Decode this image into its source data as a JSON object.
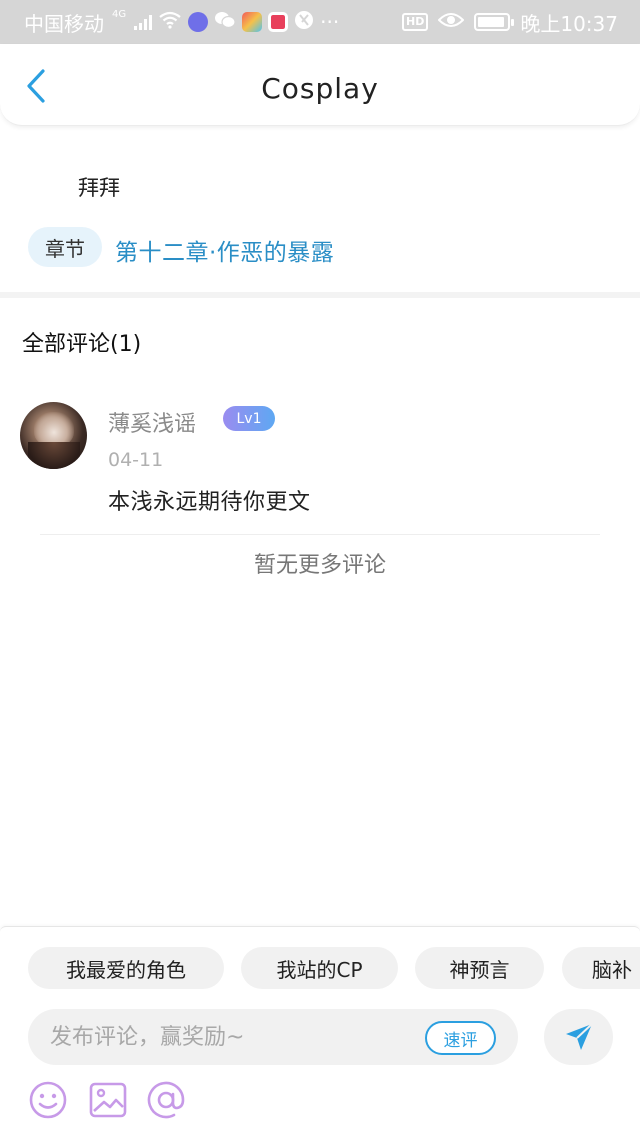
{
  "status_bar": {
    "carrier": "中国移动",
    "network": "4G",
    "time": "晚上10:37",
    "hd": "HD",
    "more": "···",
    "icons": [
      "signal-icon",
      "wifi-icon",
      "music-app-icon",
      "wechat-icon",
      "app-icon",
      "app-icon",
      "browser-icon",
      "eye-icon",
      "battery-icon"
    ]
  },
  "nav": {
    "title": "Cosplay",
    "back_icon": "chevron-left-icon"
  },
  "post": {
    "text": "拜拜",
    "chapter_tag": "章节",
    "chapter_title": "第十二章·作恶的暴露"
  },
  "comments": {
    "heading": "全部评论(1)",
    "items": [
      {
        "name": "薄奚浅谣",
        "level": "Lv1",
        "date": "04-11",
        "text": "本浅永远期待你更文"
      }
    ],
    "no_more": "暂无更多评论"
  },
  "composer": {
    "chips": [
      "我最爱的角色",
      "我站的CP",
      "神预言",
      "脑补"
    ],
    "input_placeholder": "发布评论，赢奖励~",
    "quick_review": "速评",
    "icons": [
      "send-icon",
      "emoji-icon",
      "image-icon",
      "at-icon"
    ]
  },
  "colors": {
    "accent": "#2b9fe0",
    "chapter_link": "#2a8ec6",
    "tool_icon": "#c79ae8",
    "status_bar_bg": "#d6d6d6"
  }
}
